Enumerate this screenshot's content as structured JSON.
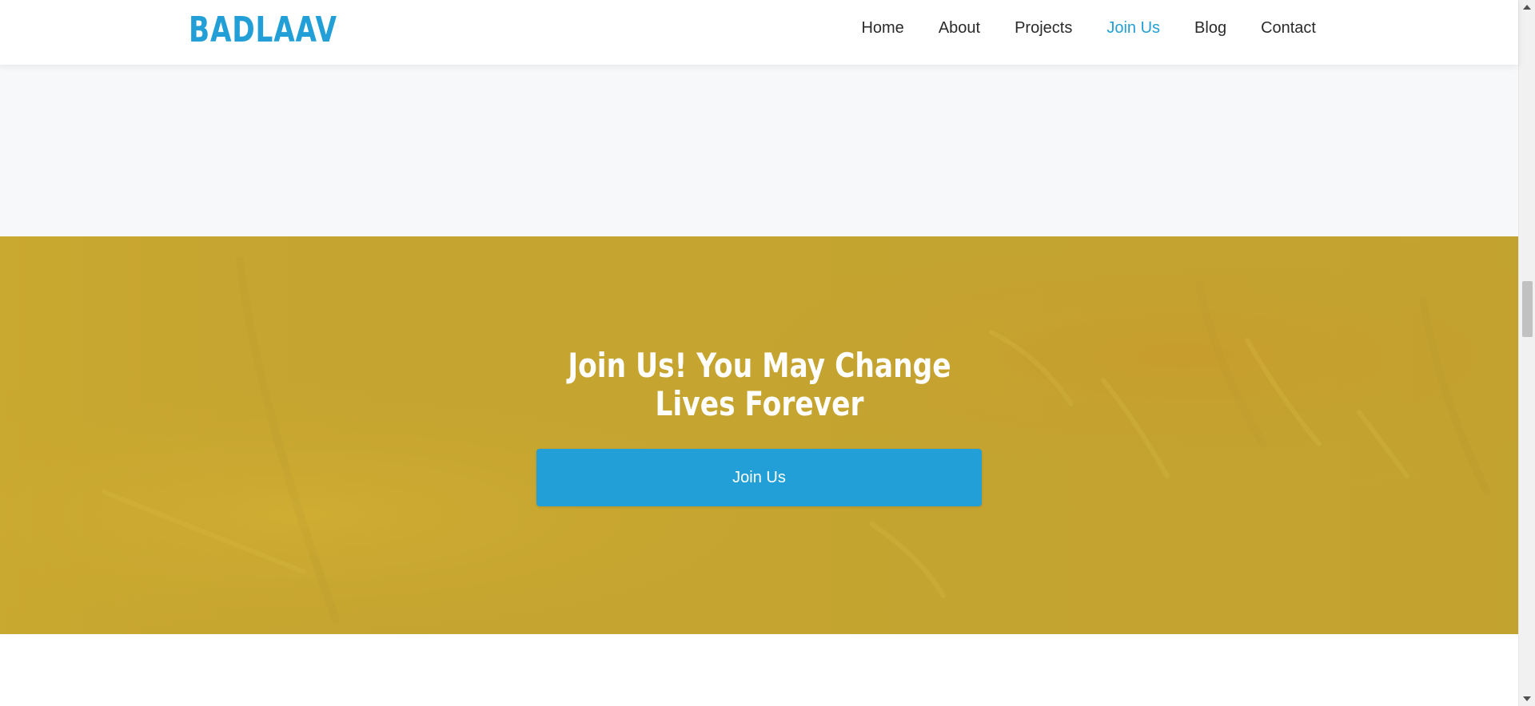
{
  "header": {
    "logo_text": "BADLAAV",
    "nav": [
      {
        "label": "Home",
        "active": false
      },
      {
        "label": "About",
        "active": false
      },
      {
        "label": "Projects",
        "active": false
      },
      {
        "label": "Join Us",
        "active": true
      },
      {
        "label": "Blog",
        "active": false
      },
      {
        "label": "Contact",
        "active": false
      }
    ]
  },
  "cta": {
    "title": "Join Us! You May Change Lives Forever",
    "button_label": "Join Us"
  },
  "colors": {
    "brand": "#229fd6",
    "cta_background": "#c5a430",
    "section_grey": "#f7f8fa",
    "nav_text": "#2a2a2a"
  },
  "icons": {
    "scroll_up": "scroll-up-arrow-icon",
    "scroll_down": "scroll-down-arrow-icon"
  }
}
